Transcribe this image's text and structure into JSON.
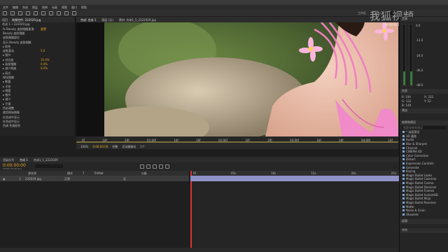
{
  "window": {
    "title": "Adobe After Effects CC 2015 - 无标题项目.aep"
  },
  "menu": [
    "文件",
    "编辑",
    "合成",
    "图层",
    "效果",
    "动画",
    "视图",
    "窗口",
    "帮助"
  ],
  "toolbar": {
    "workspace_label": "工作区",
    "search_placeholder": "搜索帮助"
  },
  "effects_panel": {
    "tabs": [
      "项目",
      "效果控件: 222029.jpg"
    ],
    "layer_title": "合成 1 • 222029.jpg",
    "rows": [
      {
        "label": "fx Beauty 皮肤细腻柔滑",
        "value": "重置"
      },
      {
        "label": "Beauty 皮肤细腻",
        "value": ""
      },
      {
        "label": "皮肤细腻部位",
        "value": ""
      },
      {
        "label": "显示 Beauty 皮肤细腻",
        "value": ""
      },
      {
        "label": "▸ 肤色",
        "value": ""
      },
      {
        "label": "皮肤柔化",
        "value": "5.0"
      },
      {
        "label": "▸ 细节",
        "value": ""
      },
      {
        "label": "▸ 对比度",
        "value": "15.0%"
      },
      {
        "label": "▸ 局部细腻",
        "value": "0.0%"
      },
      {
        "label": "▸ 减少瑕疵",
        "value": "0.0%"
      },
      {
        "label": "▸ 高光",
        "value": ""
      },
      {
        "label": "锐化细腻",
        "value": ""
      },
      {
        "label": "▸ 数量",
        "value": ""
      },
      {
        "label": "▸ 半径",
        "value": ""
      },
      {
        "label": "▸ 阈值",
        "value": ""
      },
      {
        "label": "▸ 细节",
        "value": ""
      },
      {
        "label": "▸ 减少",
        "value": ""
      },
      {
        "label": "▸ 平滑",
        "value": ""
      },
      {
        "label": "色彩调整",
        "value": ""
      },
      {
        "label": "使用原始图像",
        "value": ""
      },
      {
        "label": "在合成中显示",
        "value": ""
      },
      {
        "label": "在合成中显示",
        "value": ""
      },
      {
        "label": "色调 色相颜色",
        "value": ""
      }
    ]
  },
  "viewer": {
    "tabs": [
      "合成: 合成 1",
      "图层 (无)",
      "素材: 合成1_5_2222029.jpg"
    ],
    "time_marks": [
      "0f",
      "10f",
      "20f",
      "01:00f",
      "10f",
      "20f",
      "02:00f",
      "10f",
      "20f",
      "03:00f",
      "10f",
      "20f",
      "04:00f",
      "10f"
    ],
    "controls": {
      "zoom": "100%",
      "timecode": "0:00:00:00",
      "quality": "完整",
      "camera": "活动摄像机",
      "view": "1个"
    }
  },
  "timeline": {
    "tabs": [
      "渲染队列",
      "合成 1",
      "合成1_5_2222029"
    ],
    "timecode": "0:00:00:00",
    "fps_note": "00000 (25.00 fps)",
    "columns": [
      "源名称",
      "模式",
      "T",
      "TrkMat",
      "父级"
    ],
    "layer": {
      "index": "1",
      "name": "222029.jpg",
      "mode": "正常",
      "parent": "无"
    },
    "ruler": [
      "0f",
      "05s",
      "10s",
      "15s",
      "20s",
      "25s"
    ]
  },
  "right_panel": {
    "sections": [
      "音频",
      "信息",
      "预览",
      "效果和预设",
      "段落",
      "字符"
    ],
    "meter_labels": [
      "0.0",
      "-12.0",
      "-24.0",
      "-36.0",
      "-48.0"
    ],
    "info": {
      "x": "X: 232",
      "y": "Y: 52",
      "r": "R: 194",
      "g": "G: 132",
      "b": "B: 148"
    },
    "effects_search": "搜索效果和预设",
    "effects_list": [
      "* 动画预设",
      "3D 通道",
      "Audio",
      "Blur & Sharpen",
      "Channel",
      "CINEMA 4D",
      "Color Correction",
      "Distort",
      "Expression Controls",
      "Generate",
      "Keying",
      "Magic Bullet Looks",
      "Magic Bullet Colorista",
      "Magic Bullet Cosmo",
      "Magic Bullet Denoiser",
      "Magic Bullet Frames",
      "Magic Bullet InstantHD",
      "Magic Bullet Mojo",
      "Magic Bullet Renoiser",
      "Matte",
      "Noise & Grain",
      "Obsolete"
    ]
  },
  "watermark": {
    "main": "我狐视频",
    "sub": "www.hohu.com"
  }
}
